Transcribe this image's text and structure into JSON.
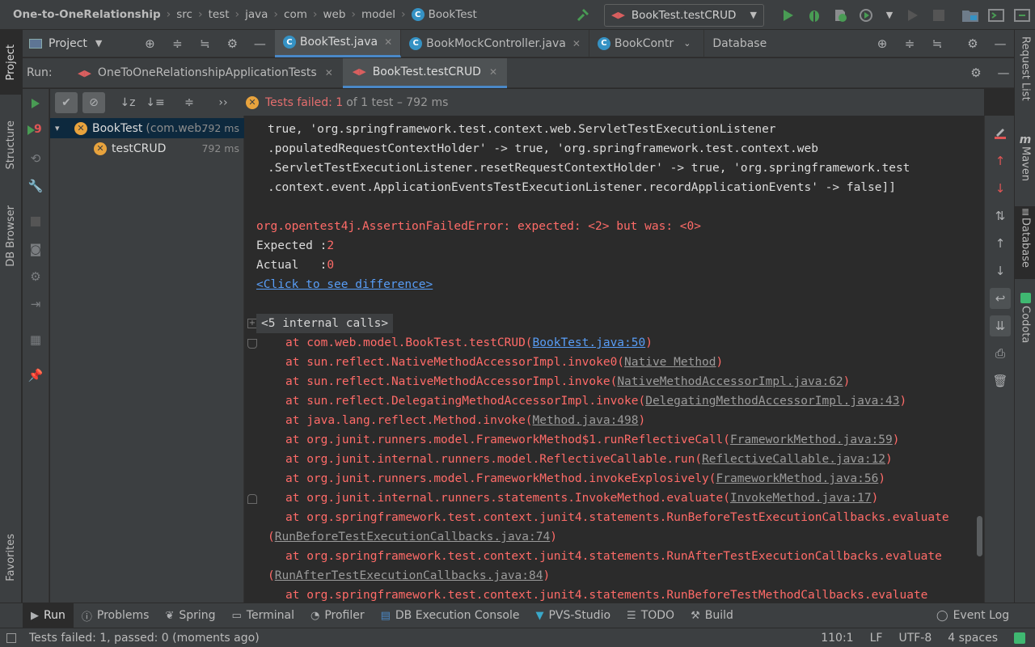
{
  "breadcrumb": [
    "One-to-OneRelationship",
    "src",
    "test",
    "java",
    "com",
    "web",
    "model",
    "BookTest"
  ],
  "run_config": "BookTest.testCRUD",
  "project_panel": {
    "label": "Project"
  },
  "editor_tabs": [
    {
      "label": "BookTest.java",
      "active": true
    },
    {
      "label": "BookMockController.java",
      "active": false
    },
    {
      "label": "BookContr",
      "active": false
    }
  ],
  "database_panel": {
    "label": "Database"
  },
  "left_strip": {
    "project": "Project",
    "structure": "Structure",
    "db_browser": "DB Browser",
    "favorites": "Favorites"
  },
  "right_strip": {
    "request_list": "Request List",
    "maven": "Maven",
    "database": "Database",
    "codota": "Codota"
  },
  "run": {
    "label": "Run:",
    "tabs": [
      {
        "label": "OneToOneRelationshipApplicationTests",
        "active": false
      },
      {
        "label": "BookTest.testCRUD",
        "active": true
      }
    ],
    "failed_badge": "9",
    "status": {
      "main": "Tests failed: 1",
      "detail": "of 1 test – 792 ms"
    },
    "tree": [
      {
        "name": "BookTest",
        "suffix": "(com.web.",
        "time": "792 ms"
      },
      {
        "name": "testCRUD",
        "suffix": "",
        "time": "792 ms"
      }
    ]
  },
  "console": {
    "prefix_lines": [
      "true, 'org.springframework.test.context.web.ServletTestExecutionListener",
      ".populatedRequestContextHolder' -> true, 'org.springframework.test.context.web",
      ".ServletTestExecutionListener.resetRequestContextHolder' -> true, 'org.springframework.test",
      ".context.event.ApplicationEventsTestExecutionListener.recordApplicationEvents' -> false]]"
    ],
    "error": "org.opentest4j.AssertionFailedError: expected: <2> but was: <0>",
    "expected_label": "Expected :",
    "expected_value": "2",
    "actual_label": "Actual   :",
    "actual_value": "0",
    "diff_link": "<Click to see difference>",
    "internal_calls": "<5 internal calls>",
    "stack": [
      {
        "text": "at com.web.model.BookTest.testCRUD(",
        "link": "BookTest.java:50",
        "close": ")",
        "blue": true
      },
      {
        "text": "at sun.reflect.NativeMethodAccessorImpl.invoke0(",
        "link": "Native Method",
        "close": ")"
      },
      {
        "text": "at sun.reflect.NativeMethodAccessorImpl.invoke(",
        "link": "NativeMethodAccessorImpl.java:62",
        "close": ")"
      },
      {
        "text": "at sun.reflect.DelegatingMethodAccessorImpl.invoke(",
        "link": "DelegatingMethodAccessorImpl.java:43",
        "close": ")"
      },
      {
        "text": "at java.lang.reflect.Method.invoke(",
        "link": "Method.java:498",
        "close": ")"
      },
      {
        "text": "at org.junit.runners.model.FrameworkMethod$1.runReflectiveCall(",
        "link": "FrameworkMethod.java:59",
        "close": ")"
      },
      {
        "text": "at org.junit.internal.runners.model.ReflectiveCallable.run(",
        "link": "ReflectiveCallable.java:12",
        "close": ")"
      },
      {
        "text": "at org.junit.runners.model.FrameworkMethod.invokeExplosively(",
        "link": "FrameworkMethod.java:56",
        "close": ")"
      },
      {
        "text": "at org.junit.internal.runners.statements.InvokeMethod.evaluate(",
        "link": "InvokeMethod.java:17",
        "close": ")"
      },
      {
        "text": "at org.springframework.test.context.junit4.statements.RunBeforeTestExecutionCallbacks.evaluate",
        "link": "",
        "close": ""
      },
      {
        "text": "(",
        "link": "RunBeforeTestExecutionCallbacks.java:74",
        "close": ")",
        "cont": true
      },
      {
        "text": "at org.springframework.test.context.junit4.statements.RunAfterTestExecutionCallbacks.evaluate",
        "link": "",
        "close": ""
      },
      {
        "text": "(",
        "link": "RunAfterTestExecutionCallbacks.java:84",
        "close": ")",
        "cont": true
      },
      {
        "text": "at org.springframework.test.context.junit4.statements.RunBeforeTestMethodCallbacks.evaluate",
        "link": "",
        "close": ""
      }
    ]
  },
  "bottom_tabs": [
    "Run",
    "Problems",
    "Spring",
    "Terminal",
    "Profiler",
    "DB Execution Console",
    "PVS-Studio",
    "TODO",
    "Build"
  ],
  "event_log": "Event Log",
  "statusbar": {
    "message": "Tests failed: 1, passed: 0 (moments ago)",
    "position": "110:1",
    "line_sep": "LF",
    "encoding": "UTF-8",
    "indent": "4 spaces"
  },
  "colors": {
    "accent": "#4a88c7",
    "error": "#ff6b68",
    "run_green": "#499c54",
    "warn_orange": "#e8a33d"
  }
}
